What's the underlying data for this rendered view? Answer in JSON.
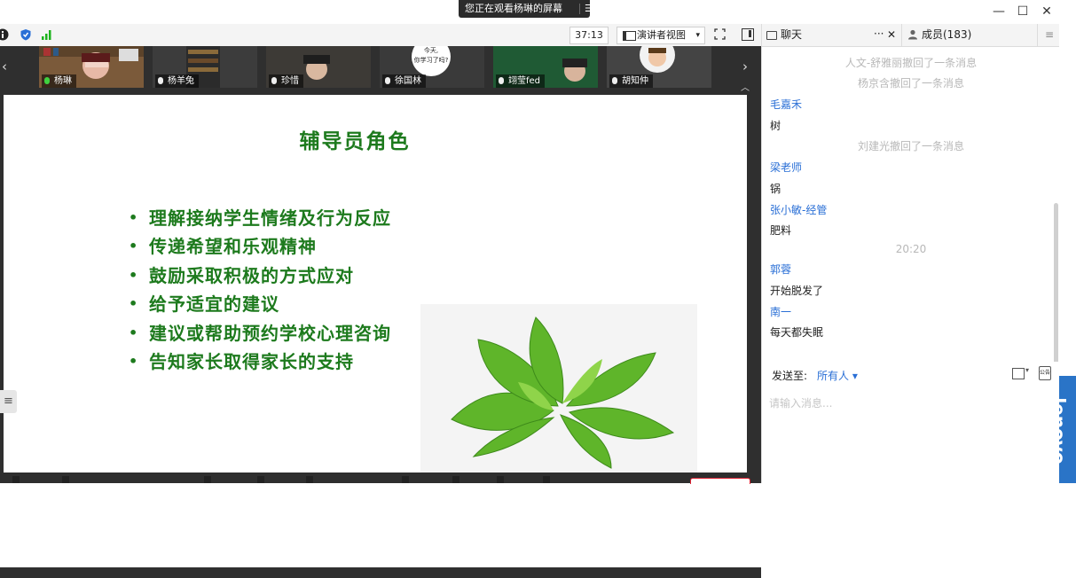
{
  "banner": {
    "text": "您正在观看杨琳的屏幕",
    "menu_icon": "☰"
  },
  "window": {
    "minimize": "—",
    "maximize": "☐",
    "close": "✕"
  },
  "toolbar": {
    "timer": "37:13",
    "view_mode": "演讲者视图",
    "view_arrow": "▾"
  },
  "video_tiles": [
    {
      "name": "杨琳",
      "mic": "on"
    },
    {
      "name": "杨羊兔",
      "mic": "muted"
    },
    {
      "name": "珍惜",
      "mic": "muted"
    },
    {
      "name": "徐国林",
      "mic": "muted",
      "bubble": "今天,\n你学习了吗?"
    },
    {
      "name": "翊莹fed",
      "mic": "muted"
    },
    {
      "name": "胡知仲",
      "mic": "muted"
    }
  ],
  "slide": {
    "title": "辅导员角色",
    "bullets": [
      "理解接纳学生情绪及行为反应",
      "传递希望和乐观精神",
      "鼓励采取积极的方式应对",
      "给予适宜的建议",
      "建议或帮助预约学校心理咨询",
      "告知家长取得家长的支持"
    ],
    "bullet_char": "•"
  },
  "chat": {
    "tab_label": "聊天",
    "tab_more": "···",
    "tab_close": "✕",
    "members_label": "成员(183)",
    "menu_icon": "≡",
    "messages": [
      {
        "type": "system",
        "text": "人文-舒雅丽撤回了一条消息"
      },
      {
        "type": "system",
        "text": "杨京含撤回了一条消息"
      },
      {
        "type": "sender",
        "text": "毛嘉禾"
      },
      {
        "type": "msg",
        "text": "树"
      },
      {
        "type": "system",
        "text": "刘建光撤回了一条消息"
      },
      {
        "type": "sender",
        "text": "梁老师"
      },
      {
        "type": "msg",
        "text": "锅"
      },
      {
        "type": "sender",
        "text": "张小敏-经管"
      },
      {
        "type": "msg",
        "text": "肥料"
      },
      {
        "type": "system",
        "text": "20:20"
      },
      {
        "type": "sender",
        "text": "郭蓉"
      },
      {
        "type": "msg",
        "text": "开始脱发了"
      },
      {
        "type": "sender",
        "text": "南一"
      },
      {
        "type": "msg",
        "text": "每天都失眠"
      }
    ],
    "send_to_label": "发送至:",
    "recipient": "所有人 ▾",
    "input_placeholder": "请输入消息...",
    "report_icon_text": "公告"
  },
  "brand": {
    "text": "lenovo",
    "color": "#2a74c7"
  },
  "colors": {
    "slide_green": "#1d7a1d",
    "sender_blue": "#2a6fd6",
    "system_gray": "#b8b8b8"
  }
}
